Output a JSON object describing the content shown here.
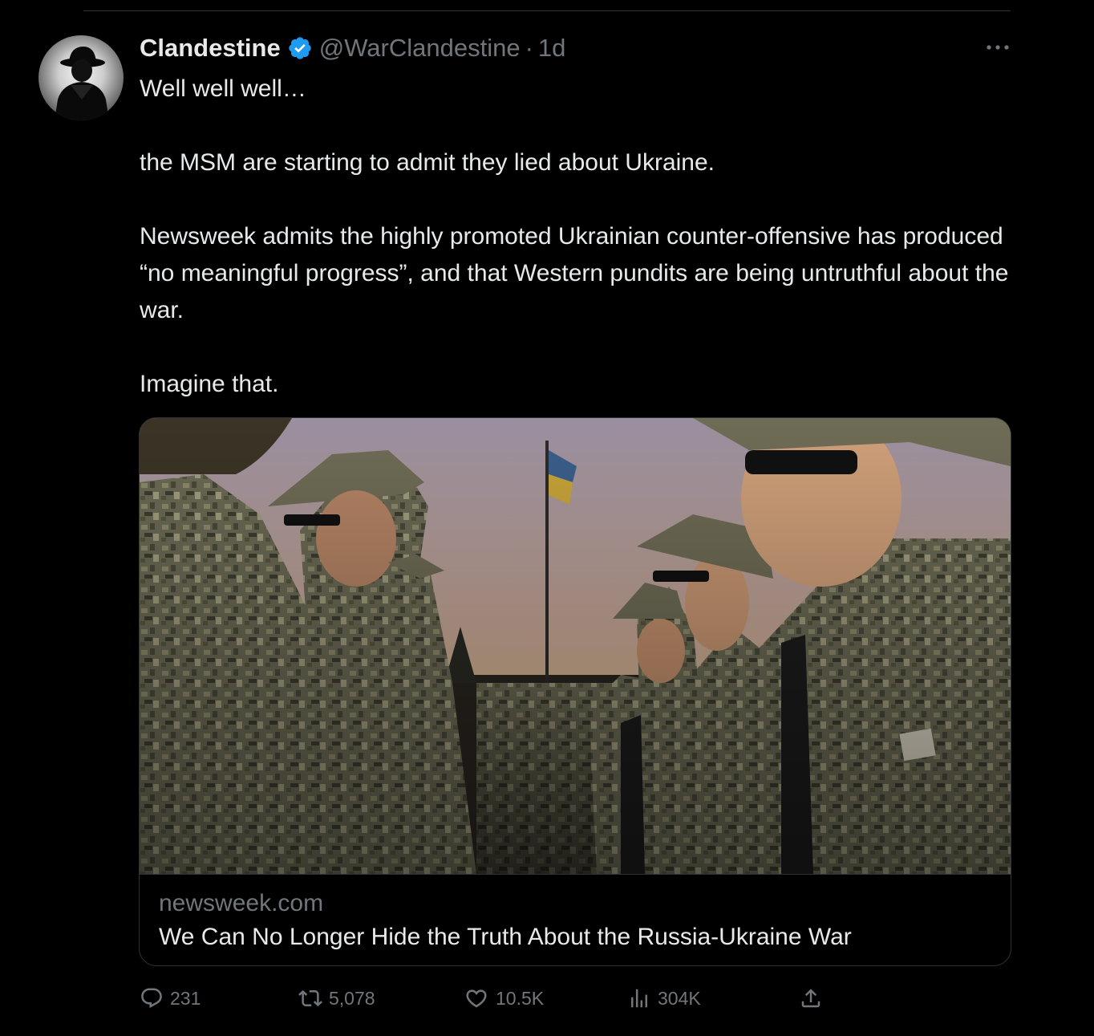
{
  "tweet": {
    "display_name": "Clandestine",
    "handle": "@WarClandestine",
    "separator": "·",
    "time": "1d",
    "paragraphs": [
      "Well well well…",
      "the MSM are starting to admit they lied about Ukraine.",
      "Newsweek admits the highly promoted Ukrainian counter-offensive has produced “no meaningful progress”, and that Western pundits are being untruthful about the war.",
      "Imagine that."
    ]
  },
  "card": {
    "domain": "newsweek.com",
    "title": "We Can No Longer Hide the Truth About the Russia-Ukraine War"
  },
  "actions": {
    "replies": "231",
    "retweets": "5,078",
    "likes": "10.5K",
    "views": "304K"
  },
  "icons": {
    "verified": "verified-badge-icon",
    "more": "more-icon",
    "reply": "reply-icon",
    "retweet": "retweet-icon",
    "like": "heart-icon",
    "views": "views-icon",
    "share": "share-icon"
  },
  "colors": {
    "background": "#000000",
    "text": "#e7e9ea",
    "muted": "#71767b",
    "verified": "#1d9bf0",
    "border": "#2f3336"
  }
}
